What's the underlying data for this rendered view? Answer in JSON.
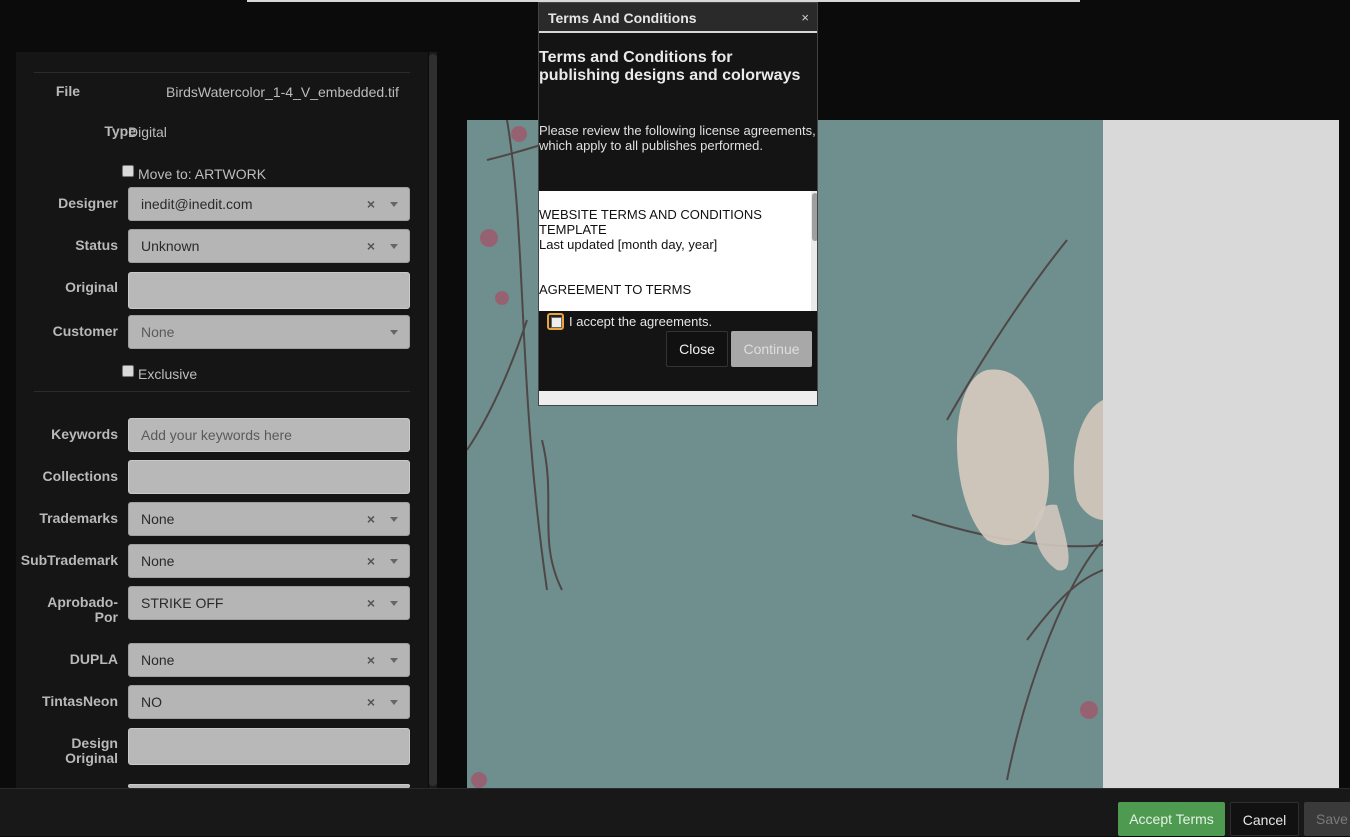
{
  "form": {
    "file_label": "File",
    "file_value": "BirdsWatercolor_1-4_V_embedded.tif",
    "type_label": "Type",
    "type_value": "Digital",
    "move_to": "Move to: ARTWORK",
    "designer_label": "Designer",
    "designer_value": "inedit@inedit.com",
    "status_label": "Status",
    "status_value": "Unknown",
    "original_label": "Original",
    "original_value": "",
    "customer_label": "Customer",
    "customer_value": "None",
    "exclusive_label": "Exclusive",
    "keywords_label": "Keywords",
    "keywords_placeholder": "Add your keywords here",
    "collections_label": "Collections",
    "collections_value": "",
    "trademarks_label": "Trademarks",
    "trademarks_value": "None",
    "subtrademark_label": "SubTrademark",
    "subtrademark_value": "None",
    "aprobado_label_1": "Aprobado-",
    "aprobado_label_2": "Por",
    "aprobado_value": "STRIKE OFF",
    "dupla_label": "DUPLA",
    "dupla_value": "None",
    "tintasneon_label": "TintasNeon",
    "tintasneon_value": "NO",
    "design_original_label_1": "Design",
    "design_original_label_2": "Original",
    "design_original_value": "",
    "clear_glyph": "×"
  },
  "modal": {
    "title": "Terms And Conditions",
    "close_glyph": "×",
    "heading": "Terms and Conditions for publishing designs and colorways",
    "description": "Please review the following license agreements, which apply to all publishes performed.",
    "terms_line_1": "WEBSITE TERMS AND CONDITIONS TEMPLATE",
    "terms_line_2": "Last updated [month day, year]",
    "terms_line_3": "AGREEMENT TO TERMS",
    "accept_label": "I accept the agreements.",
    "close_button": "Close",
    "continue_button": "Continue"
  },
  "footer": {
    "accept_terms": "Accept Terms",
    "cancel": "Cancel",
    "save": "Save"
  },
  "colors": {
    "accent_green": "#4d9a50",
    "focus_orange": "#e8a33a",
    "preview_bg": "#6f8f8e"
  }
}
